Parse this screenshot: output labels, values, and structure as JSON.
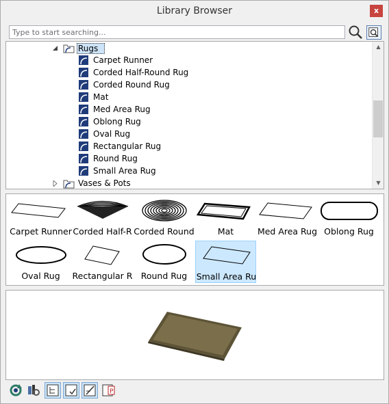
{
  "window": {
    "title": "Library Browser",
    "close_label": "x"
  },
  "search": {
    "placeholder": "Type to start searching...",
    "value": ""
  },
  "tree": {
    "parent": {
      "label": "Rugs",
      "expanded": true
    },
    "items": [
      {
        "label": "Carpet Runner"
      },
      {
        "label": "Corded Half-Round Rug"
      },
      {
        "label": "Corded Round Rug"
      },
      {
        "label": "Mat"
      },
      {
        "label": "Med Area Rug"
      },
      {
        "label": "Oblong Rug"
      },
      {
        "label": "Oval Rug"
      },
      {
        "label": "Rectangular Rug"
      },
      {
        "label": "Round Rug"
      },
      {
        "label": "Small Area Rug"
      }
    ],
    "next_folder": {
      "label": "Vases & Pots",
      "expanded": false
    }
  },
  "grid": {
    "items": [
      {
        "label": "Carpet Runner",
        "icon": "carpet-runner-thumbnail"
      },
      {
        "label": "Corded Half-R",
        "icon": "corded-half-round-thumbnail"
      },
      {
        "label": "Corded Round",
        "icon": "corded-round-thumbnail"
      },
      {
        "label": "Mat",
        "icon": "mat-thumbnail"
      },
      {
        "label": "Med Area Rug",
        "icon": "med-area-rug-thumbnail"
      },
      {
        "label": "Oblong Rug",
        "icon": "oblong-rug-thumbnail"
      },
      {
        "label": "Oval Rug",
        "icon": "oval-rug-thumbnail"
      },
      {
        "label": "Rectangular R",
        "icon": "rectangular-rug-thumbnail"
      },
      {
        "label": "Round Rug",
        "icon": "round-rug-thumbnail"
      },
      {
        "label": "Small Area Ru",
        "icon": "small-area-rug-thumbnail",
        "selected": true
      }
    ]
  },
  "preview": {
    "object": "small-area-rug-3d-preview",
    "rug_color": "#7a6f4a",
    "border_color": "#5d5336"
  },
  "toolbar": {
    "buttons": [
      {
        "icon": "refresh-library-icon",
        "active": false
      },
      {
        "icon": "library-settings-icon",
        "active": false
      },
      {
        "icon": "show-tree-view-icon",
        "active": true
      },
      {
        "icon": "show-thumbnail-view-icon",
        "active": true
      },
      {
        "icon": "show-preview-icon",
        "active": true
      },
      {
        "icon": "show-properties-icon",
        "active": false
      }
    ]
  },
  "colors": {
    "accent": "#1f3b7a",
    "selection": "#cce8ff",
    "close": "#c7443f"
  }
}
